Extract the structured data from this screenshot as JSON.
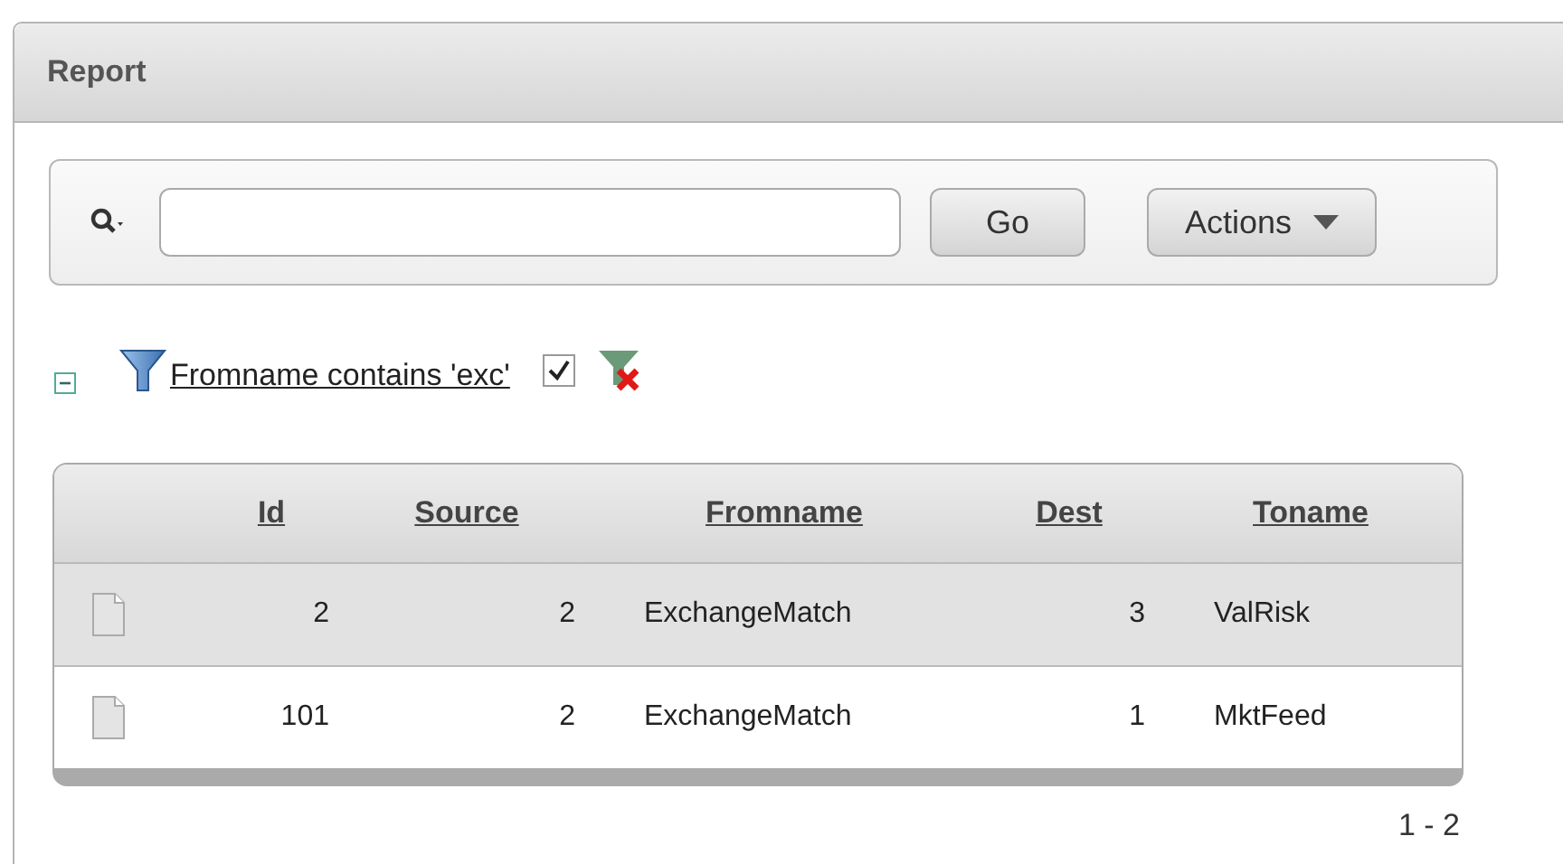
{
  "region": {
    "title": "Report"
  },
  "search": {
    "go_label": "Go",
    "actions_label": "Actions"
  },
  "filter": {
    "expanded": true,
    "text": "Fromname contains 'exc'",
    "enabled": true
  },
  "table": {
    "columns": [
      "Id",
      "Source",
      "Fromname",
      "Dest",
      "Toname"
    ],
    "rows": [
      {
        "cells": [
          "2",
          "2",
          "ExchangeMatch",
          "3",
          "ValRisk"
        ],
        "highlighted": true
      },
      {
        "cells": [
          "101",
          "2",
          "ExchangeMatch",
          "1",
          "MktFeed"
        ],
        "highlighted": false
      }
    ]
  },
  "pagination": "1 - 2"
}
